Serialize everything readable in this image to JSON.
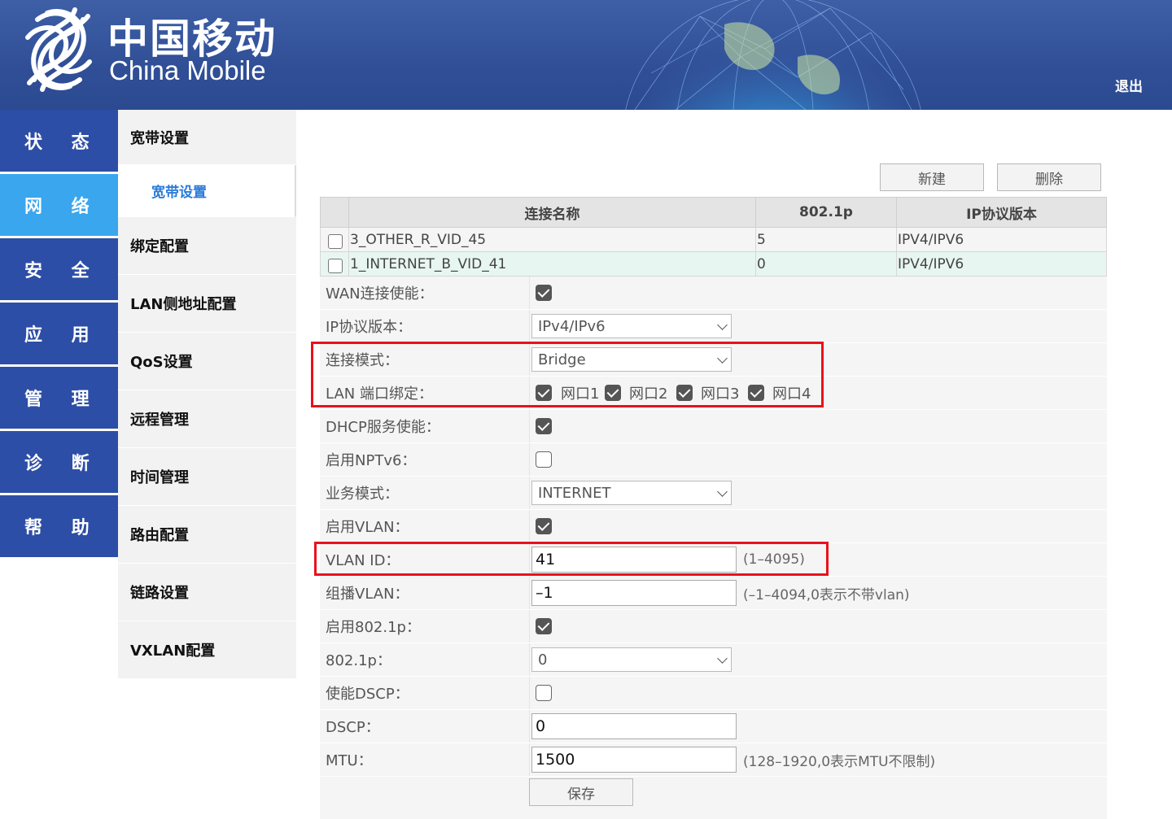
{
  "header": {
    "logo_cn": "中国移动",
    "logo_en": "China Mobile",
    "logout": "退出"
  },
  "nav_left": [
    {
      "label": "状 态",
      "active": false
    },
    {
      "label": "网 络",
      "active": true
    },
    {
      "label": "安 全",
      "active": false
    },
    {
      "label": "应 用",
      "active": false
    },
    {
      "label": "管 理",
      "active": false
    },
    {
      "label": "诊 断",
      "active": false
    },
    {
      "label": "帮 助",
      "active": false
    }
  ],
  "nav_sub": {
    "group": "宽带设置",
    "child": "宽带设置",
    "items": [
      "绑定配置",
      "LAN侧地址配置",
      "QoS设置",
      "远程管理",
      "时间管理",
      "路由配置",
      "链路设置",
      "VXLAN配置"
    ]
  },
  "toolbar": {
    "new_label": "新建",
    "delete_label": "删除"
  },
  "table": {
    "headers": [
      "连接名称",
      "802.1p",
      "IP协议版本"
    ],
    "rows": [
      {
        "name": "3_OTHER_R_VID_45",
        "p8021": "5",
        "ip": "IPV4/IPV6"
      },
      {
        "name": "1_INTERNET_B_VID_41",
        "p8021": "0",
        "ip": "IPV4/IPV6"
      }
    ]
  },
  "form": {
    "wan_enable": {
      "label": "WAN连接使能：",
      "checked": true
    },
    "ip_version": {
      "label": "IP协议版本：",
      "value": "IPv4/IPv6"
    },
    "conn_mode": {
      "label": "连接模式：",
      "value": "Bridge"
    },
    "lan_bind": {
      "label": "LAN 端口绑定：",
      "ports": [
        "网口1",
        "网口2",
        "网口3",
        "网口4"
      ]
    },
    "dhcp": {
      "label": "DHCP服务使能：",
      "checked": true
    },
    "nptv6": {
      "label": "启用NPTv6：",
      "checked": false
    },
    "service_mode": {
      "label": "业务模式：",
      "value": "INTERNET"
    },
    "vlan_enable": {
      "label": "启用VLAN：",
      "checked": true
    },
    "vlan_id": {
      "label": "VLAN ID：",
      "value": "41",
      "hint": "(1–4095)"
    },
    "mcast_vlan": {
      "label": "组播VLAN：",
      "value": "–1",
      "hint": "(–1–4094,0表示不带vlan)"
    },
    "p8021_enable": {
      "label": "启用802.1p：",
      "checked": true
    },
    "p8021": {
      "label": "802.1p：",
      "value": "0"
    },
    "dscp_enable": {
      "label": "使能DSCP：",
      "checked": false
    },
    "dscp": {
      "label": "DSCP：",
      "value": "0"
    },
    "mtu": {
      "label": "MTU：",
      "value": "1500",
      "hint": "(128–1920,0表示MTU不限制)"
    },
    "save_label": "保存"
  },
  "colors": {
    "header_blue": "#304f97",
    "nav_blue": "#2d4ea6",
    "nav_active": "#3aa6ee",
    "highlight_red": "#e8121b"
  }
}
